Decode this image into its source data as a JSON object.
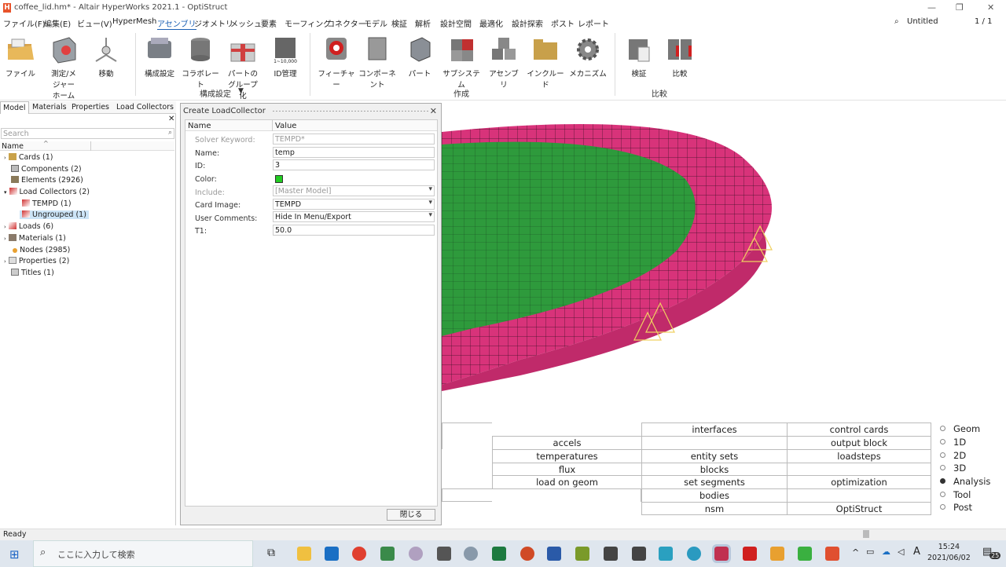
{
  "window": {
    "title": "coffee_lid.hm* - Altair HyperWorks 2021.1 - OptiStruct",
    "session_name": "Untitled",
    "page_counter": "1 / 1"
  },
  "menu": [
    "ファイル(F)",
    "編集(E)",
    "ビュー(V)",
    "HyperMesh",
    "アセンブリ",
    "ジオメトリ",
    "メッシュ",
    "要素",
    "モーフィング",
    "コネクター",
    "モデル",
    "検証",
    "解析",
    "設計空間",
    "最適化",
    "設計探索",
    "ポスト",
    "レポート"
  ],
  "ribbon": {
    "file": "ファイル",
    "measure_home": [
      "測定/メ",
      "ジャー",
      "ホーム"
    ],
    "move": "移動",
    "config": "構成設定",
    "collaborate": "コラボレート",
    "part_group": [
      "パートの",
      "グループ化"
    ],
    "id_manage": "ID管理",
    "feature": "フィーチャー",
    "component": "コンポーネント",
    "part": "パート",
    "subsystem": "サブシステム",
    "assembly": "アセンブリ",
    "include": "インクルード",
    "mechanism": "メカニズム",
    "verify": "検証",
    "compare": "比較",
    "group_config": "構成設定",
    "group_create": "作成",
    "group_compare": "比較",
    "id_icon_text": "1~10,000"
  },
  "left_tabs": [
    "Model",
    "Materials",
    "Properties",
    "Load Collectors"
  ],
  "search_placeholder": "Search",
  "tree_header": "Name",
  "tree": [
    {
      "label": "Cards  (1)"
    },
    {
      "label": "Components  (2)"
    },
    {
      "label": "Elements  (2926)"
    },
    {
      "label": "Load Collectors  (2)"
    },
    {
      "label": "TEMPD  (1)"
    },
    {
      "label": "Ungrouped  (1)"
    },
    {
      "label": "Loads  (6)"
    },
    {
      "label": "Materials  (1)"
    },
    {
      "label": "Nodes  (2985)"
    },
    {
      "label": "Properties  (2)"
    },
    {
      "label": "Titles  (1)"
    }
  ],
  "dialog": {
    "title": "Create LoadCollector",
    "col_name": "Name",
    "col_value": "Value",
    "rows": [
      {
        "label": "Solver Keyword:",
        "value": "TEMPD*"
      },
      {
        "label": "Name:",
        "value": "temp"
      },
      {
        "label": "ID:",
        "value": "3"
      },
      {
        "label": "Color:",
        "value": ""
      },
      {
        "label": "Include:",
        "value": "[Master Model]"
      },
      {
        "label": "Card Image:",
        "value": "TEMPD"
      },
      {
        "label": "User Comments:",
        "value": "Hide In Menu/Export"
      },
      {
        "label": "T1:",
        "value": "50.0"
      }
    ],
    "color_value": "#22cc22",
    "close_button": "閉じる"
  },
  "panel_grid": {
    "col2": [
      "",
      "accels",
      "temperatures",
      "flux",
      "load on geom",
      ""
    ],
    "col3": [
      "interfaces",
      "",
      "entity sets",
      "blocks",
      "set segments",
      "bodies",
      "nsm"
    ],
    "col4": [
      "control cards",
      "output block",
      "loadsteps",
      "",
      "optimization",
      "",
      "OptiStruct"
    ]
  },
  "radios": [
    {
      "label": "Geom",
      "on": false
    },
    {
      "label": "1D",
      "on": false
    },
    {
      "label": "2D",
      "on": false
    },
    {
      "label": "3D",
      "on": false
    },
    {
      "label": "Analysis",
      "on": true
    },
    {
      "label": "Tool",
      "on": false
    },
    {
      "label": "Post",
      "on": false
    }
  ],
  "status": "Ready",
  "taskbar": {
    "search_placeholder": "ここに入力して検索",
    "time": "15:24",
    "date": "2021/06/02",
    "ime": "A",
    "notif": "25"
  },
  "colors": {
    "mesh_green": "#2e9a3c",
    "mesh_pink": "#d8337a",
    "selected_bg": "#cce4f7"
  }
}
